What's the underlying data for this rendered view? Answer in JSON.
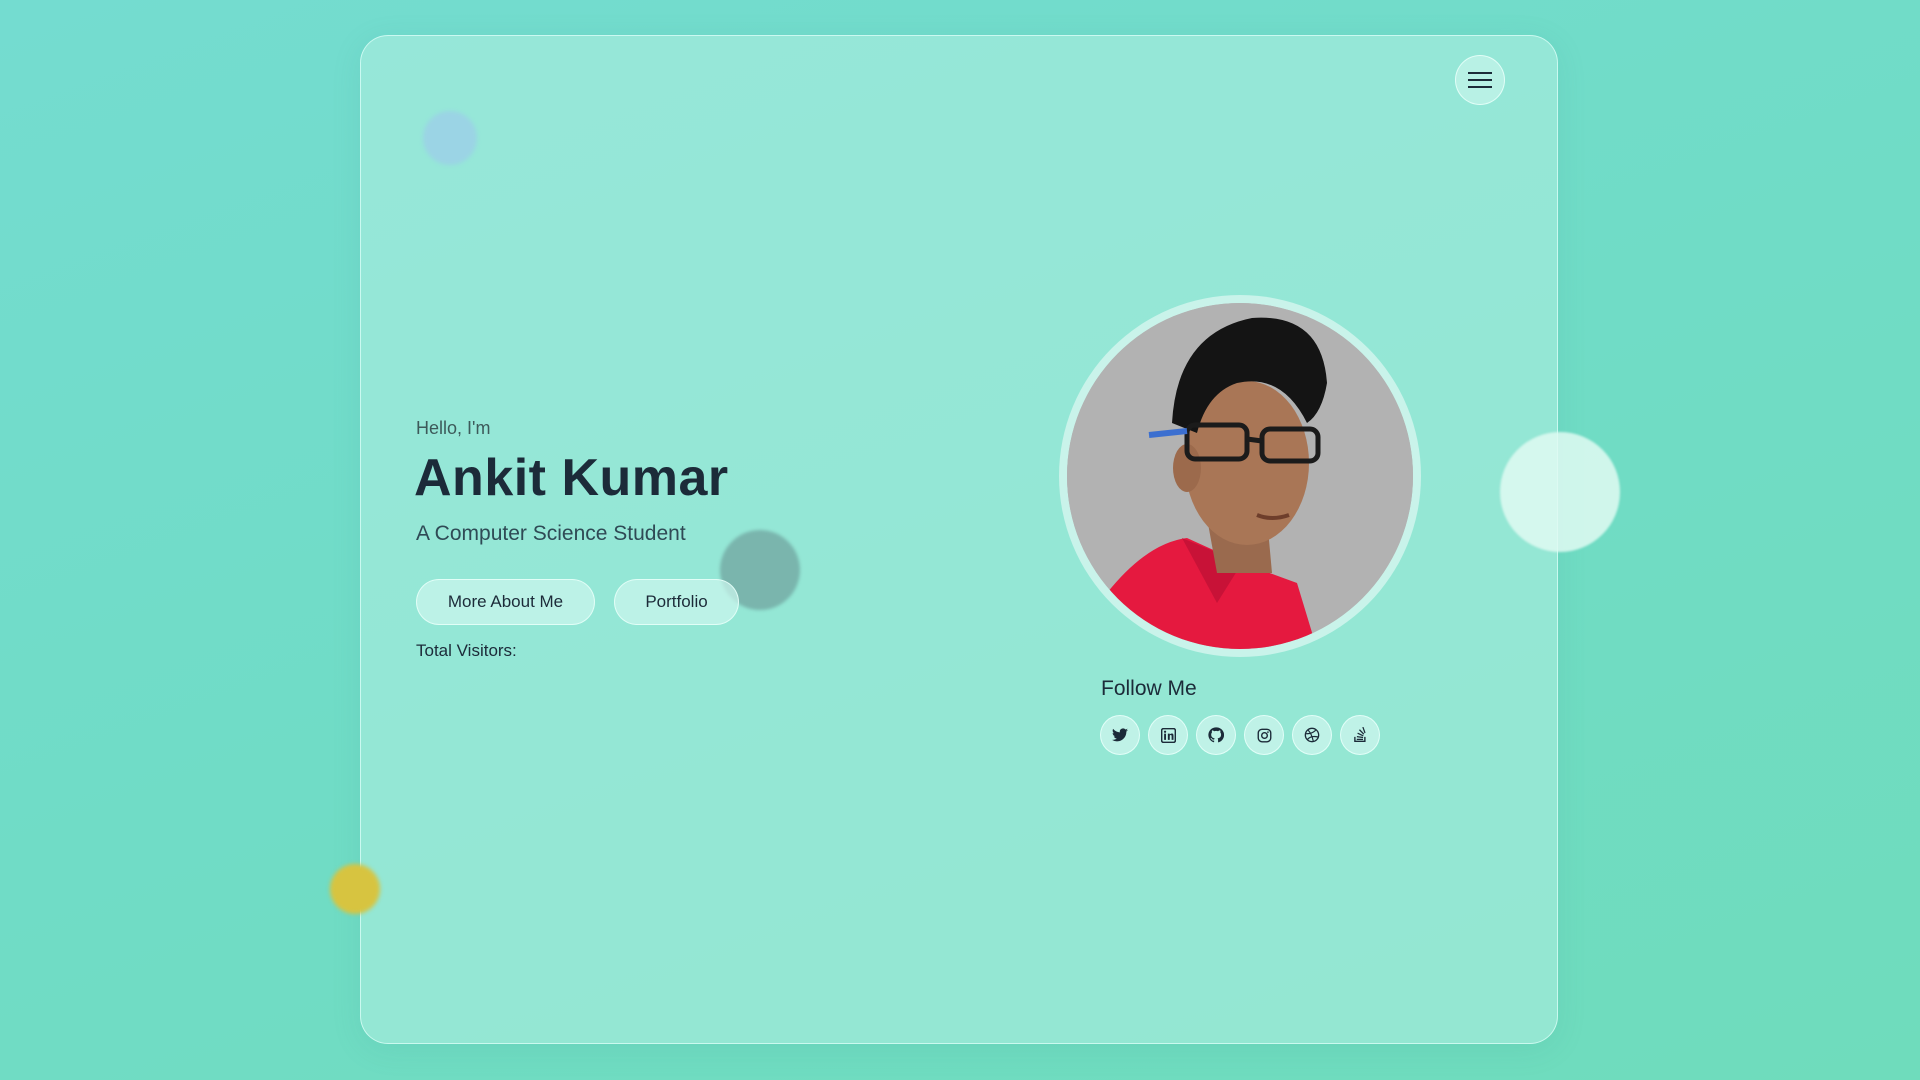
{
  "hero": {
    "greeting": "Hello, I'm",
    "name": "Ankit Kumar",
    "subtitle": "A Computer Science Student",
    "buttons": [
      {
        "label": "More About Me"
      },
      {
        "label": "Portfolio"
      }
    ],
    "visitors_label": "Total Visitors:"
  },
  "menu": {
    "icon": "hamburger-menu-icon"
  },
  "profile": {
    "photo": "profile-photo"
  },
  "follow": {
    "title": "Follow Me",
    "links": [
      {
        "icon": "twitter-icon"
      },
      {
        "icon": "linkedin-icon"
      },
      {
        "icon": "github-icon"
      },
      {
        "icon": "instagram-icon"
      },
      {
        "icon": "dribbble-icon"
      },
      {
        "icon": "stackoverflow-icon"
      }
    ]
  },
  "colors": {
    "background": "#72dccc",
    "card": "#9de8da",
    "text_dark": "#1c2b39",
    "blob_blue": "#7fb1e8",
    "blob_yellow": "#d7c440"
  }
}
